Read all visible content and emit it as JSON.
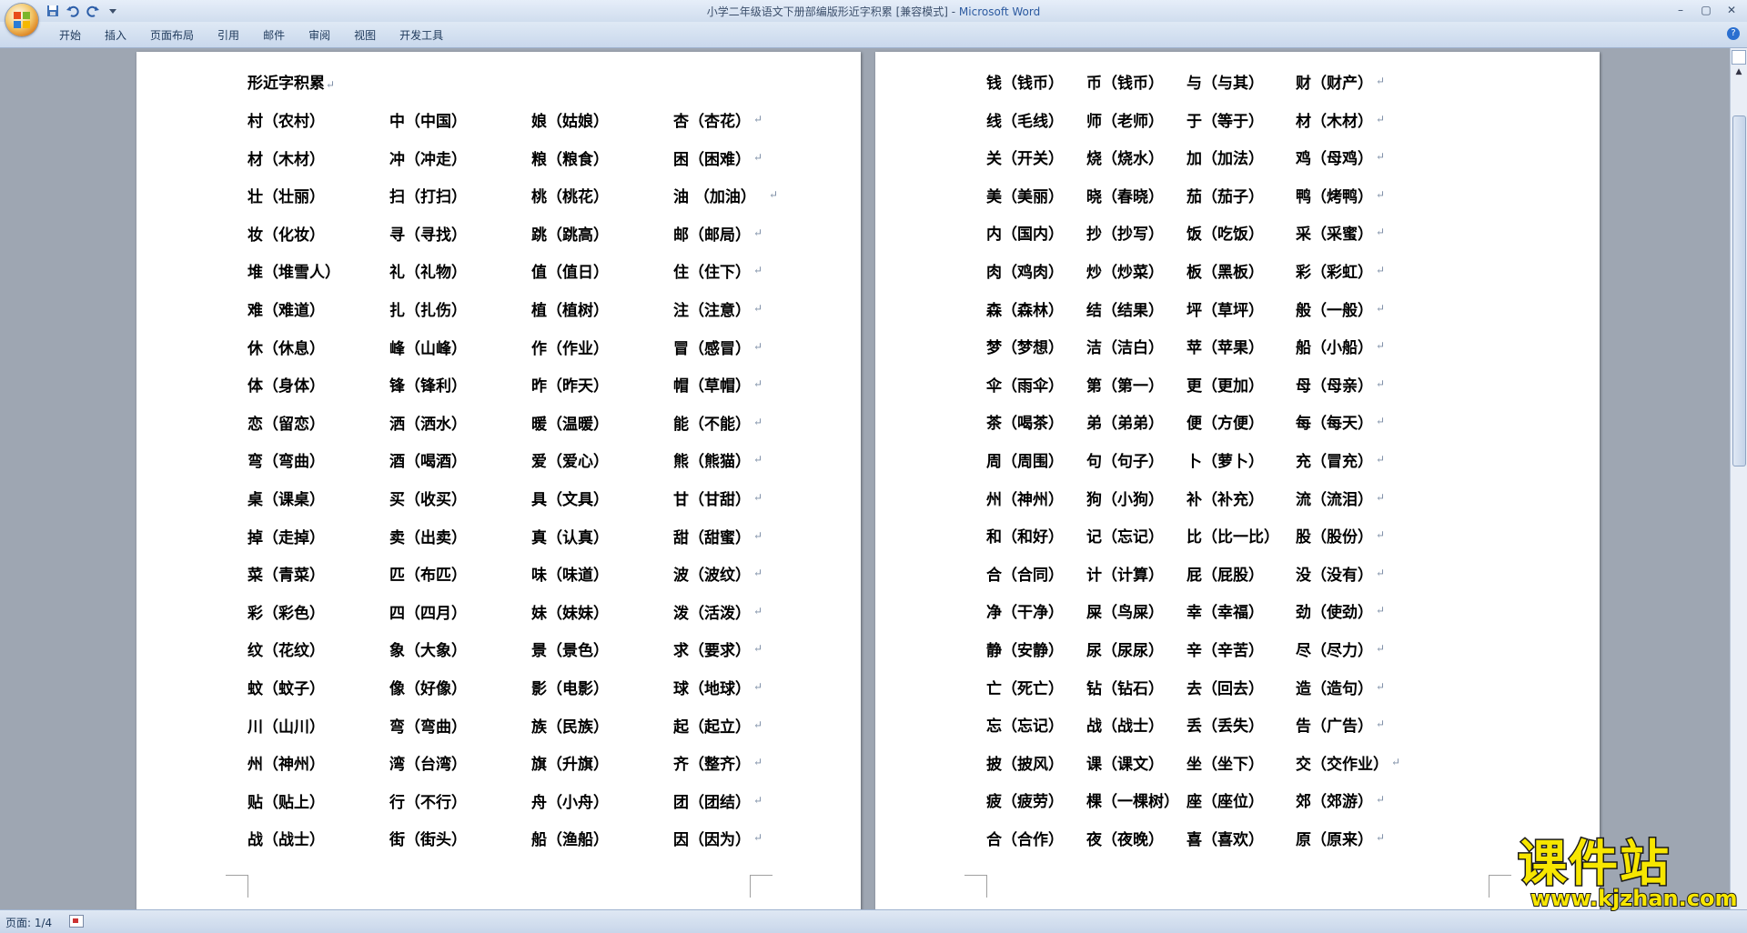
{
  "window": {
    "title_prefix": "小学二年级语文下册部编版形近字积累 [兼容模式] - ",
    "title_app": "Microsoft Word"
  },
  "ribbon": {
    "tabs": [
      "开始",
      "插入",
      "页面布局",
      "引用",
      "邮件",
      "审阅",
      "视图",
      "开发工具"
    ]
  },
  "document": {
    "heading": "形近字积累",
    "left_page_rows": [
      [
        "村（农村）",
        "中（中国）",
        "娘（姑娘）",
        "杏（杏花）"
      ],
      [
        "材（木材）",
        "冲（冲走）",
        "粮（粮食）",
        "困（困难）"
      ],
      [
        "壮（壮丽）",
        "扫（打扫）",
        "桃（桃花）",
        "油 （加油）"
      ],
      [
        "妆（化妆）",
        "寻（寻找）",
        "跳（跳高）",
        "邮（邮局）"
      ],
      [
        "堆（堆雪人）",
        "礼（礼物）",
        "值（值日）",
        "住（住下）"
      ],
      [
        "难（难道）",
        "扎（扎伤）",
        "植（植树）",
        "注（注意）"
      ],
      [
        "休（休息）",
        "峰（山峰）",
        "作（作业）",
        "冒（感冒）"
      ],
      [
        "体（身体）",
        "锋（锋利）",
        "昨（昨天）",
        "帽（草帽）"
      ],
      [
        "恋（留恋）",
        "洒（洒水）",
        "暖（温暖）",
        "能（不能）"
      ],
      [
        "弯（弯曲）",
        "酒（喝酒）",
        "爱（爱心）",
        "熊（熊猫）"
      ],
      [
        "桌（课桌）",
        "买（收买）",
        "具（文具）",
        "甘（甘甜）"
      ],
      [
        "掉（走掉）",
        "卖（出卖）",
        "真（认真）",
        "甜（甜蜜）"
      ],
      [
        "菜（青菜）",
        "匹（布匹）",
        "味（味道）",
        "波（波纹）"
      ],
      [
        "彩（彩色）",
        "四（四月）",
        "妹（妹妹）",
        "泼（活泼）"
      ],
      [
        "纹（花纹）",
        "象（大象）",
        "景（景色）",
        "求（要求）"
      ],
      [
        "蚊（蚊子）",
        "像（好像）",
        "影（电影）",
        "球（地球）"
      ],
      [
        "川（山川）",
        "弯（弯曲）",
        "族（民族）",
        "起（起立）"
      ],
      [
        "州（神州）",
        "湾（台湾）",
        "旗（升旗）",
        "齐（整齐）"
      ],
      [
        "贴（贴上）",
        "行（不行）",
        "舟（小舟）",
        "团（团结）"
      ],
      [
        "战（战士）",
        "街（街头）",
        "船（渔船）",
        "因（因为）"
      ]
    ],
    "right_page_rows": [
      [
        "钱（钱币）",
        "币（钱币）",
        "与（与其）",
        "财（财产）"
      ],
      [
        "线（毛线）",
        "师（老师）",
        "于（等于）",
        "材（木材）"
      ],
      [
        "关（开关）",
        "烧（烧水）",
        "加（加法）",
        "鸡（母鸡）"
      ],
      [
        "美（美丽）",
        "晓（春晓）",
        "茄（茄子）",
        "鸭（烤鸭）"
      ],
      [
        "内（国内）",
        "抄（抄写）",
        "饭（吃饭）",
        "采（采蜜）"
      ],
      [
        "肉（鸡肉）",
        "炒（炒菜）",
        "板（黑板）",
        "彩（彩虹）"
      ],
      [
        "森（森林）",
        "结（结果）",
        "坪（草坪）",
        "般（一般）"
      ],
      [
        "梦（梦想）",
        "洁（洁白）",
        "苹（苹果）",
        "船（小船）"
      ],
      [
        "伞（雨伞）",
        "第（第一）",
        "更（更加）",
        "母（母亲）"
      ],
      [
        "茶（喝茶）",
        "弟（弟弟）",
        "便（方便）",
        "每（每天）"
      ],
      [
        "周（周围）",
        "句（句子）",
        "卜（萝卜）",
        "充（冒充）"
      ],
      [
        "州（神州）",
        "狗（小狗）",
        "补（补充）",
        "流（流泪）"
      ],
      [
        "和（和好）",
        "记（忘记）",
        "比（比一比）",
        "股（股份）"
      ],
      [
        "合（合同）",
        "计（计算）",
        "屁（屁股）",
        "没（没有）"
      ],
      [
        "净（干净）",
        "屎（鸟屎）",
        "幸（幸福）",
        "劲（使劲）"
      ],
      [
        "静（安静）",
        "尿（尿尿）",
        "辛（辛苦）",
        "尽（尽力）"
      ],
      [
        "亡（死亡）",
        "钻（钻石）",
        "去（回去）",
        "造（造句）"
      ],
      [
        "忘（忘记）",
        "战（战士）",
        "丢（丢失）",
        "告（广告）"
      ],
      [
        "披（披风）",
        "课（课文）",
        "坐（坐下）",
        "交（交作业）"
      ],
      [
        "疲（疲劳）",
        "棵（一棵树）",
        "座（座位）",
        "郊（郊游）"
      ],
      [
        "合（合作）",
        "夜（夜晚）",
        "喜（喜欢）",
        "原（原来）"
      ]
    ],
    "paragraph_mark": "↵"
  },
  "status_bar": {
    "page": "页面: 1/4"
  },
  "watermark": {
    "main": "课件站",
    "url": "www.kjzhan.com"
  },
  "icons": [
    "office-logo-icon",
    "save-icon",
    "undo-icon",
    "redo-icon",
    "customize-qat-icon",
    "help-icon",
    "ruler-toggle-icon",
    "spellcheck-icon"
  ]
}
